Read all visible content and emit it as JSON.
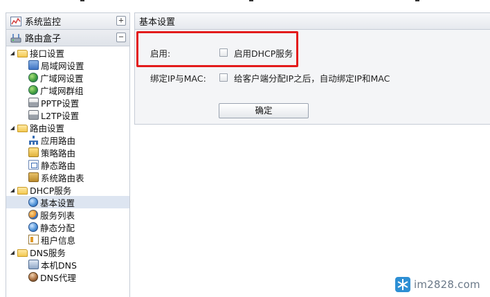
{
  "sidebar": {
    "header_monitor": "系统监控",
    "header_monitor_toggle": "+",
    "header_router": "路由盒子",
    "header_router_toggle": "−",
    "tree": {
      "interface": {
        "label": "接口设置",
        "children": [
          "局域网设置",
          "广域网设置",
          "广域网群组",
          "PPTP设置",
          "L2TP设置"
        ]
      },
      "routing": {
        "label": "路由设置",
        "children": [
          "应用路由",
          "策略路由",
          "静态路由",
          "系统路由表"
        ]
      },
      "dhcp": {
        "label": "DHCP服务",
        "children": [
          "基本设置",
          "服务列表",
          "静态分配",
          "租户信息"
        ]
      },
      "dns": {
        "label": "DNS服务",
        "children": [
          "本机DNS",
          "DNS代理"
        ]
      }
    }
  },
  "main": {
    "title": "基本设置",
    "enable_label": "启用:",
    "enable_option": "启用DHCP服务",
    "bind_label": "绑定IP与MAC:",
    "bind_option": "给客户端分配IP之后，自动绑定IP和MAC",
    "confirm_label": "确定"
  },
  "colors": {
    "highlight": "#e31b1b",
    "selected_row": "#dde5f1",
    "border": "#c6ccd6"
  },
  "watermark": "im2828.com"
}
